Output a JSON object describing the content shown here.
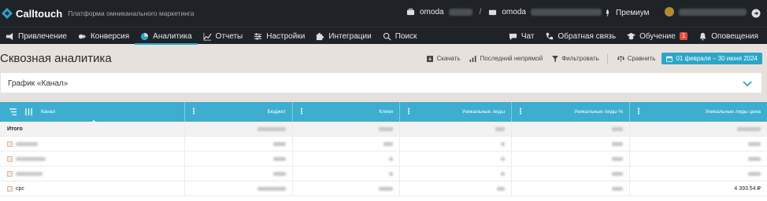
{
  "header": {
    "logo_text": "Calltouch",
    "tagline": "Платформа омниканального маркетинга",
    "project_1": "omoda",
    "project_2": "omoda",
    "premium_label": "Премиум"
  },
  "nav": {
    "left": [
      {
        "label": "Привлечение",
        "icon": "megaphone-icon"
      },
      {
        "label": "Конверсия",
        "icon": "conversion-icon"
      },
      {
        "label": "Аналитика",
        "icon": "pie-chart-icon",
        "active": true
      },
      {
        "label": "Отчеты",
        "icon": "chart-line-icon"
      },
      {
        "label": "Настройки",
        "icon": "sliders-icon"
      },
      {
        "label": "Интеграции",
        "icon": "puzzle-icon"
      },
      {
        "label": "Поиск",
        "icon": "search-icon"
      }
    ],
    "right": [
      {
        "label": "Чат",
        "icon": "chat-icon"
      },
      {
        "label": "Обратная связь",
        "icon": "phone-icon"
      },
      {
        "label": "Обучение",
        "icon": "graduation-cap-icon",
        "badge": "1"
      },
      {
        "label": "Оповещения",
        "icon": "bell-icon"
      }
    ]
  },
  "page": {
    "title": "Сквозная аналитика",
    "tools": {
      "download": "Скачать",
      "attribution": "Последний непрямой",
      "filter": "Фильтровать",
      "compare": "Сравнить",
      "date_range": "01 февраля – 30 июня 2024"
    },
    "chart_title": "График «Канал»"
  },
  "table": {
    "columns": [
      "Канал",
      "Бюджет",
      "Клики",
      "Уникальные лиды",
      "Уникальные лиды %",
      "Уникальные лиды цена"
    ],
    "rows": [
      {
        "name": "Итого",
        "total": true
      },
      {
        "name": ""
      },
      {
        "name": ""
      },
      {
        "name": ""
      },
      {
        "name": "cpc",
        "last_value": "4 393.54 ₽"
      }
    ]
  },
  "colors": {
    "header_bg": "#1f2327",
    "accent": "#2aa6c9",
    "table_header": "#3daecf",
    "page_bg": "#e6e1dc"
  }
}
